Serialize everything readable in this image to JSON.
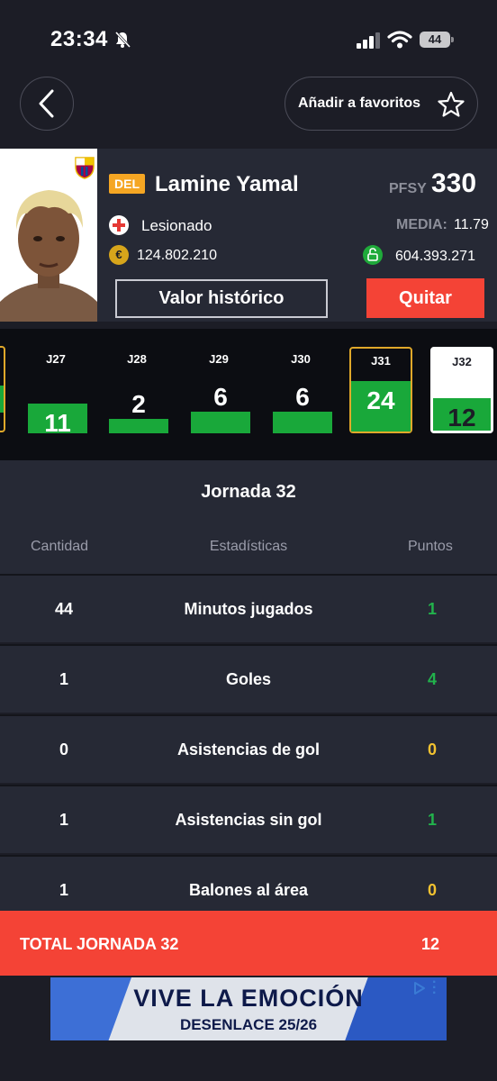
{
  "status_bar": {
    "time": "23:34",
    "battery": "44"
  },
  "nav": {
    "favorites_label": "Añadir a favoritos"
  },
  "player": {
    "position": "DEL",
    "name": "Lamine Yamal",
    "pfsy_label": "PFSY",
    "pfsy_value": "330",
    "status": "Lesionado",
    "media_label": "MEDIA:",
    "media_value": "11.79",
    "market_value": "124.802.210",
    "clause_value": "604.393.271",
    "history_button": "Valor histórico",
    "remove_button": "Quitar",
    "colors": {
      "position_badge": "#f5a623",
      "remove": "#f44336",
      "injury": "#e53935"
    }
  },
  "rounds": [
    {
      "label": "J27",
      "points": "11",
      "fill": 0.45
    },
    {
      "label": "J28",
      "points": "2",
      "fill": 0.15
    },
    {
      "label": "J29",
      "points": "6",
      "fill": 0.28
    },
    {
      "label": "J30",
      "points": "6",
      "fill": 0.28
    },
    {
      "label": "J31",
      "points": "24",
      "fill": 0.85
    },
    {
      "label": "J32",
      "points": "12",
      "fill": 0.5
    }
  ],
  "stats": {
    "title": "Jornada 32",
    "headers": {
      "quantity": "Cantidad",
      "stat": "Estadísticas",
      "points": "Puntos"
    },
    "rows": [
      {
        "quantity": "44",
        "name": "Minutos jugados",
        "points": "1",
        "points_color": "#22b24c"
      },
      {
        "quantity": "1",
        "name": "Goles",
        "points": "4",
        "points_color": "#22b24c"
      },
      {
        "quantity": "0",
        "name": "Asistencias de gol",
        "points": "0",
        "points_color": "#f2c230"
      },
      {
        "quantity": "1",
        "name": "Asistencias sin gol",
        "points": "1",
        "points_color": "#22b24c"
      },
      {
        "quantity": "1",
        "name": "Balones al área",
        "points": "0",
        "points_color": "#f2c230"
      }
    ],
    "total_label": "TOTAL JORNADA 32",
    "total_value": "12"
  },
  "ad": {
    "title": "VIVE LA EMOCIÓN",
    "subtitle": "DESENLACE   25/26"
  }
}
